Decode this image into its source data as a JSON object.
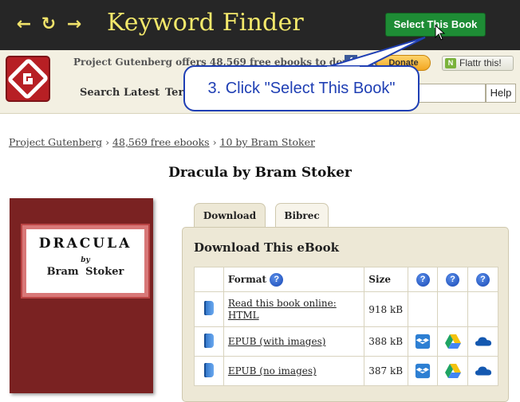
{
  "toolbar": {
    "back_icon": "arrow-left-icon",
    "refresh_icon": "refresh-icon",
    "forward_icon": "arrow-right-icon",
    "app_title": "Keyword Finder",
    "select_button": "Select This Book",
    "accent": "#f3e86b",
    "button_color": "#1e8c35"
  },
  "pg_header": {
    "offer_text": "Project Gutenberg offers 48,569 free ebooks to download.",
    "donate_label": "Donate",
    "flattr_label": "Flattr this!",
    "menu": [
      "Search",
      "Latest",
      "Ter"
    ],
    "help_label": "Help"
  },
  "callout": {
    "text": "3. Click \"Select This Book\""
  },
  "breadcrumb": {
    "items": [
      "Project Gutenberg",
      "48,569 free ebooks",
      "10 by Bram Stoker"
    ],
    "separator": "›"
  },
  "book": {
    "title": "Dracula by Bram Stoker",
    "cover_title": "DRACULA",
    "cover_by": "by",
    "cover_author": "Bram Stoker"
  },
  "tabs": [
    "Download",
    "Bibrec"
  ],
  "download": {
    "heading": "Download This eBook",
    "columns": [
      "Format",
      "Size"
    ],
    "rows": [
      {
        "format": "Read this book online: HTML",
        "size": "918 kB"
      },
      {
        "format": "EPUB (with images)",
        "size": "388 kB"
      },
      {
        "format": "EPUB (no images)",
        "size": "387 kB"
      }
    ]
  }
}
